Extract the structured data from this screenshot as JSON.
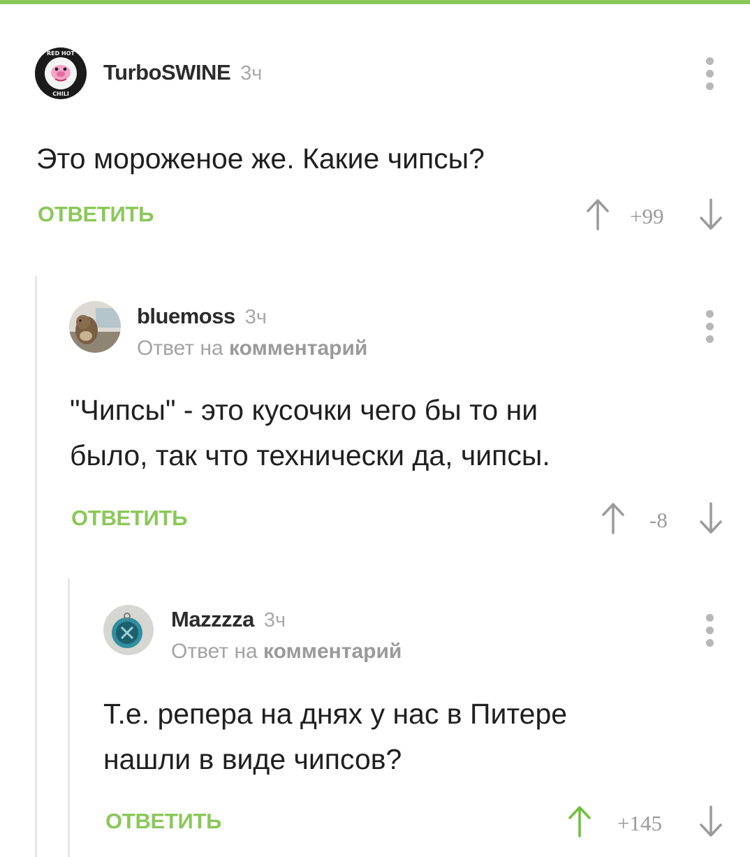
{
  "accent": "#8ac858",
  "upvote_active": "#6fbf3c",
  "comments": [
    {
      "author": "TurboSWINE",
      "time": "3ч",
      "text": "Это мороженое же. Какие чипсы?",
      "reply_label": "ОТВЕТИТЬ",
      "score": "+99",
      "upvoted": false
    },
    {
      "author": "bluemoss",
      "time": "3ч",
      "reply_note_prefix": "Ответ на",
      "reply_note_link": "комментарий",
      "text_lines": [
        "\"Чипсы\" - это кусочки чего бы то ни",
        "было, так что технически да, чипсы."
      ],
      "reply_label": "ОТВЕТИТЬ",
      "score": "-8",
      "upvoted": false
    },
    {
      "author": "Mazzzza",
      "time": "3ч",
      "reply_note_prefix": "Ответ на",
      "reply_note_link": "комментарий",
      "text_lines": [
        "Т.е. репера на днях у нас в Питере",
        "нашли в виде чипсов?"
      ],
      "reply_label": "ОТВЕТИТЬ",
      "score": "+145",
      "upvoted": true
    }
  ]
}
